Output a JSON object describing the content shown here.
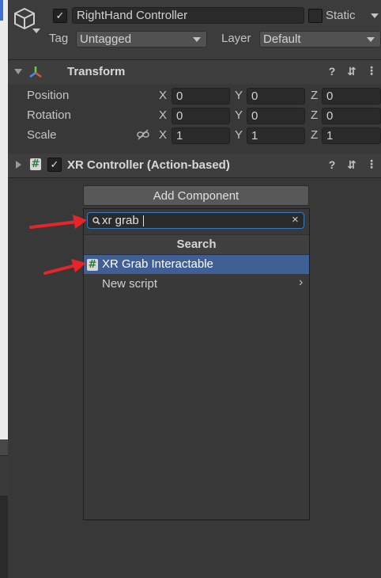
{
  "object": {
    "name": "RightHand Controller",
    "static_label": "Static",
    "tag_label": "Tag",
    "tag_value": "Untagged",
    "layer_label": "Layer",
    "layer_value": "Default"
  },
  "transform": {
    "title": "Transform",
    "rows": [
      {
        "label": "Position",
        "x": "0",
        "y": "0",
        "z": "0"
      },
      {
        "label": "Rotation",
        "x": "0",
        "y": "0",
        "z": "0"
      },
      {
        "label": "Scale",
        "x": "1",
        "y": "1",
        "z": "1"
      }
    ],
    "axis_labels": {
      "x": "X",
      "y": "Y",
      "z": "Z"
    }
  },
  "xr_controller": {
    "title": "XR Controller (Action-based)"
  },
  "add_component": {
    "button_label": "Add Component",
    "search_value": "xr grab",
    "section_title": "Search",
    "results": [
      {
        "label": "XR Grab Interactable",
        "icon": "script-hash-icon"
      },
      {
        "label": "New script",
        "icon": "chevron-right-icon"
      }
    ]
  },
  "colors": {
    "highlight": "#3f5f95",
    "arrow": "#e8242b",
    "focus": "#3a79bb"
  }
}
